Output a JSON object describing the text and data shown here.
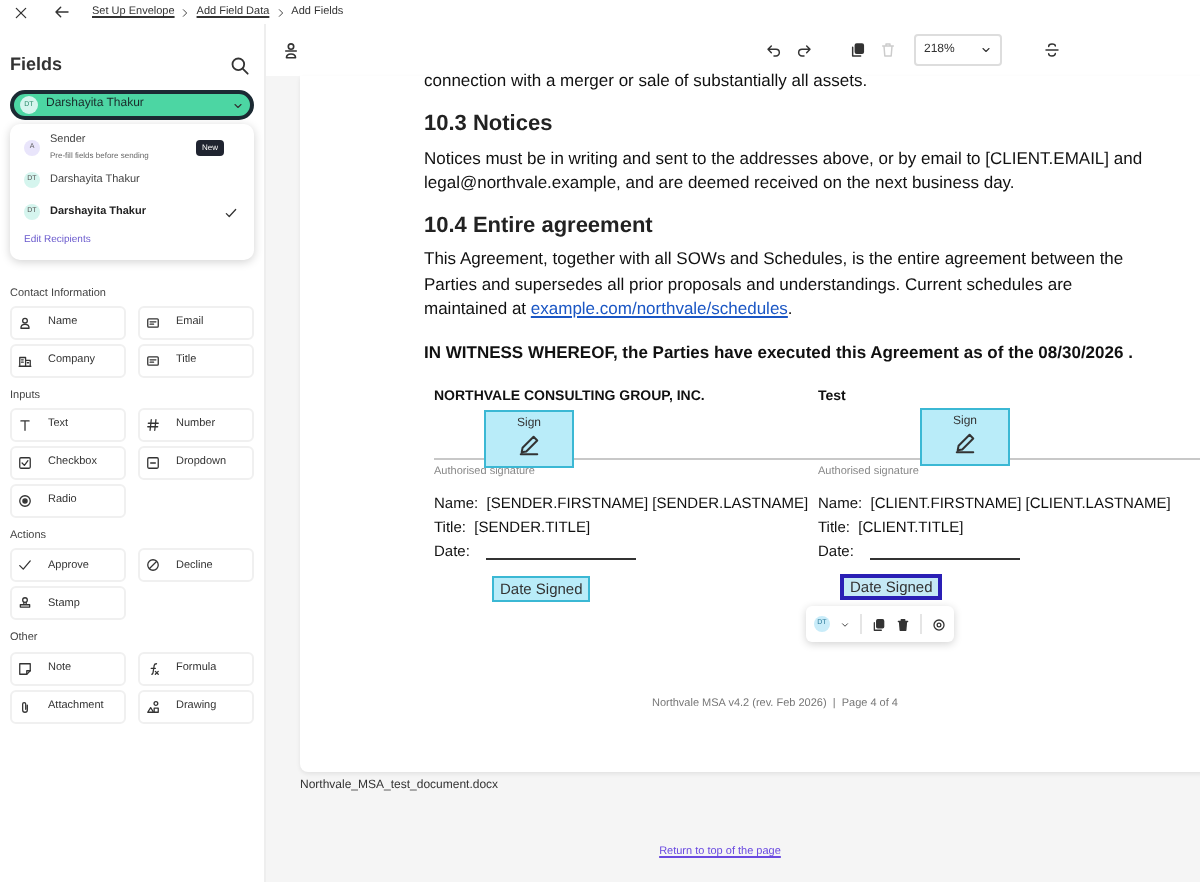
{
  "breadcrumbs": [
    {
      "label": "Set Up Envelope",
      "link": true
    },
    {
      "label": "Add Field Data",
      "link": true
    },
    {
      "label": "Add Fields",
      "link": false
    }
  ],
  "sidebar": {
    "title": "Fields",
    "recipient_select": {
      "initials": "DT",
      "label": "Darshayita Thakur"
    },
    "recipient_menu": {
      "items": [
        {
          "initials": "A",
          "name": "Sender",
          "note": "Pre-fill fields before sending",
          "badge": "New",
          "selected": false,
          "color": "#e9e5fb"
        },
        {
          "initials": "DT",
          "name": "Darshayita Thakur",
          "selected": false,
          "color": "#d5f5ee"
        },
        {
          "initials": "DT",
          "name": "Darshayita Thakur",
          "selected": true,
          "color": "#d5f5ee"
        }
      ],
      "edit_link": "Edit Recipients"
    },
    "groups": [
      {
        "title": "Contact Information",
        "fields": [
          {
            "label": "Name",
            "kind": "person"
          },
          {
            "label": "Email",
            "kind": "card"
          },
          {
            "label": "Company",
            "kind": "building"
          },
          {
            "label": "Title",
            "kind": "card"
          }
        ]
      },
      {
        "title": "Inputs",
        "fields": [
          {
            "label": "Text",
            "kind": "text"
          },
          {
            "label": "Number",
            "kind": "hash"
          },
          {
            "label": "Checkbox",
            "kind": "checkbox"
          },
          {
            "label": "Dropdown",
            "kind": "dropdown"
          },
          {
            "label": "Radio",
            "kind": "radio"
          }
        ]
      },
      {
        "title": "Actions",
        "fields": [
          {
            "label": "Approve",
            "kind": "check"
          },
          {
            "label": "Decline",
            "kind": "ban"
          },
          {
            "label": "Stamp",
            "kind": "stamp"
          }
        ]
      },
      {
        "title": "Other",
        "fields": [
          {
            "label": "Note",
            "kind": "note"
          },
          {
            "label": "Formula",
            "kind": "formula"
          },
          {
            "label": "Attachment",
            "kind": "clip"
          },
          {
            "label": "Drawing",
            "kind": "shapes"
          }
        ]
      }
    ]
  },
  "toolbar": {
    "zoom": "218%",
    "delete_disabled": true
  },
  "document": {
    "top_line": "connection with a merger or sale of substantially all assets.",
    "sections": [
      {
        "heading": "10.3  Notices",
        "text": "Notices must be in writing and sent to the addresses above, or by email to [CLIENT.EMAIL] and legal@northvale.example, and are deemed received on the next business day."
      },
      {
        "heading": "10.4  Entire agreement",
        "text": "This Agreement, together with all SOWs and Schedules, is the entire agreement between the Parties and supersedes all prior proposals and understandings. Current schedules are maintained at",
        "link": "example.com/northvale/schedules",
        "after_link": "."
      }
    ],
    "witness": "IN WITNESS WHEREOF, the Parties have executed this Agreement as of the 08/30/2026 .",
    "parties": [
      {
        "name": "NORTHVALE CONSULTING GROUP, INC.",
        "sign_caption": "Authorised signature",
        "lines": [
          "Name:  [SENDER.FIRSTNAME] [SENDER.LASTNAME]",
          "Title:  [SENDER.TITLE]"
        ],
        "date_label": "Date:",
        "sign_field": "Sign",
        "date_field": "Date Signed",
        "date_selected": false
      },
      {
        "name": "Test",
        "sign_caption": "Authorised signature",
        "lines": [
          "Name:  [CLIENT.FIRSTNAME] [CLIENT.LASTNAME]",
          "Title:  [CLIENT.TITLE]"
        ],
        "date_label": "Date:",
        "sign_field": "Sign",
        "date_field": "Date Signed",
        "date_selected": true
      }
    ],
    "field_toolbar": {
      "initials": "DT"
    },
    "footer": "Northvale MSA v4.2 (rev. Feb 2026)  |  Page 4 of 4"
  },
  "file_name": "Northvale_MSA_test_document.docx",
  "return_link": "Return to top of the page"
}
